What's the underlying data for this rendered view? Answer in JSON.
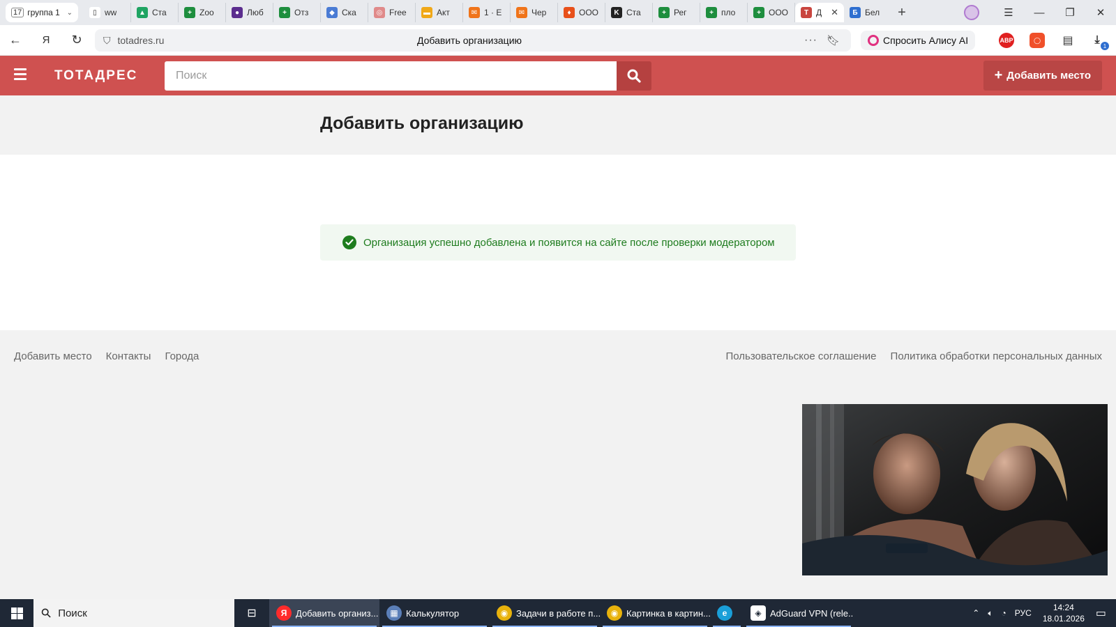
{
  "browser": {
    "tab_group": {
      "count": "17",
      "name": "группа 1"
    },
    "tabs": [
      {
        "label": "ww",
        "color": "#ffffff",
        "glyph": "▯"
      },
      {
        "label": "Ста",
        "color": "#1fa463",
        "glyph": "▲"
      },
      {
        "label": "Zoo",
        "color": "#1e8e3e",
        "glyph": "+"
      },
      {
        "label": "Люб",
        "color": "#5b2d8e",
        "glyph": "●"
      },
      {
        "label": "Отз",
        "color": "#1e8e3e",
        "glyph": "+"
      },
      {
        "label": "Ска",
        "color": "#4a7bd4",
        "glyph": "◆"
      },
      {
        "label": "Free",
        "color": "#e08a8a",
        "glyph": "◎"
      },
      {
        "label": "Акт",
        "color": "#f0a818",
        "glyph": "▬"
      },
      {
        "label": "1 · Е",
        "color": "#f0741a",
        "glyph": "✉"
      },
      {
        "label": "Чер",
        "color": "#f0741a",
        "glyph": "✉"
      },
      {
        "label": "ООО",
        "color": "#e8501a",
        "glyph": "♦"
      },
      {
        "label": "Ста",
        "color": "#222222",
        "glyph": "K"
      },
      {
        "label": "Рег",
        "color": "#1e8e3e",
        "glyph": "+"
      },
      {
        "label": "пло",
        "color": "#1e8e3e",
        "glyph": "+"
      },
      {
        "label": "ООО",
        "color": "#1e8e3e",
        "glyph": "+"
      }
    ],
    "active_tab": {
      "label": "Д",
      "color": "#c9453f",
      "glyph": "T"
    },
    "after_tab": {
      "label": "Бел",
      "color": "#2f6fd0",
      "glyph": "Б"
    },
    "url": "totadres.ru",
    "page_title": "Добавить организацию",
    "alice_label": "Спросить Алису AI",
    "extensions": {
      "abp": "ABP",
      "download_badge": "1"
    }
  },
  "site": {
    "logo": "ТОТАДРЕС",
    "search_placeholder": "Поиск",
    "add_place_label": "Добавить место",
    "brand_color": "#cf5150"
  },
  "main": {
    "title": "Добавить организацию",
    "success_message": "Организация успешно добавлена и появится на сайте после проверки модератором"
  },
  "footer": {
    "left_links": [
      "Добавить место",
      "Контакты",
      "Города"
    ],
    "right_links": [
      "Пользовательское соглашение",
      "Политика обработки персональных данных"
    ]
  },
  "taskbar": {
    "search_label": "Поиск",
    "apps": [
      {
        "label": "Добавить организ...",
        "icon": "yandex-browser-icon",
        "active": true
      },
      {
        "label": "Калькулятор",
        "icon": "calculator-icon",
        "active": false
      },
      {
        "label": "Задачи в работе п...",
        "icon": "chrome-icon",
        "active": false
      },
      {
        "label": "Картинка в картин...",
        "icon": "chrome-icon",
        "active": false
      },
      {
        "label": "",
        "icon": "edge-icon",
        "active": false
      },
      {
        "label": "AdGuard VPN (rele...",
        "icon": "adguard-icon",
        "active": false
      }
    ],
    "language": "РУС",
    "time": "14:24",
    "date": "18.01.2026"
  }
}
